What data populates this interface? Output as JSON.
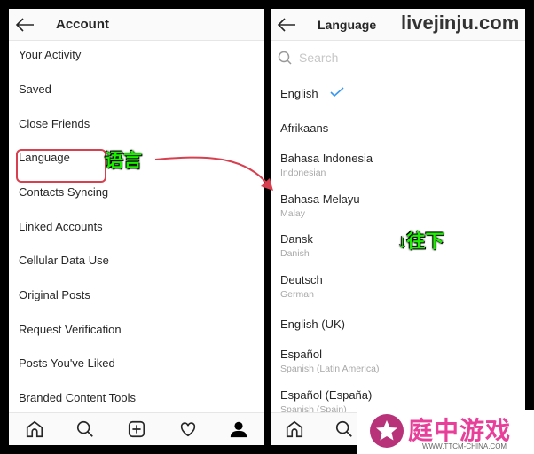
{
  "left": {
    "title": "Account",
    "items": [
      "Your Activity",
      "Saved",
      "Close Friends",
      "Language",
      "Contacts Syncing",
      "Linked Accounts",
      "Cellular Data Use",
      "Original Posts",
      "Request Verification",
      "Posts You've Liked",
      "Branded Content Tools"
    ]
  },
  "right": {
    "title": "Language",
    "search_placeholder": "Search",
    "languages": [
      {
        "name": "English",
        "sub": ""
      },
      {
        "name": "Afrikaans",
        "sub": ""
      },
      {
        "name": "Bahasa Indonesia",
        "sub": "Indonesian"
      },
      {
        "name": "Bahasa Melayu",
        "sub": "Malay"
      },
      {
        "name": "Dansk",
        "sub": "Danish"
      },
      {
        "name": "Deutsch",
        "sub": "German"
      },
      {
        "name": "English (UK)",
        "sub": ""
      },
      {
        "name": "Español",
        "sub": "Spanish (Latin America)"
      },
      {
        "name": "Español (España)",
        "sub": "Spanish (Spain)"
      }
    ],
    "selected": "English"
  },
  "annotations": {
    "language_label": "语言",
    "scroll_label": "↓往下",
    "watermark": "livejinju.com",
    "logo_text": "庭中游戏",
    "logo_url": "WWW.TTCM-CHINA.COM"
  },
  "colors": {
    "highlight": "#d8404f",
    "check": "#3897f0",
    "annotation": "#1cf000"
  }
}
